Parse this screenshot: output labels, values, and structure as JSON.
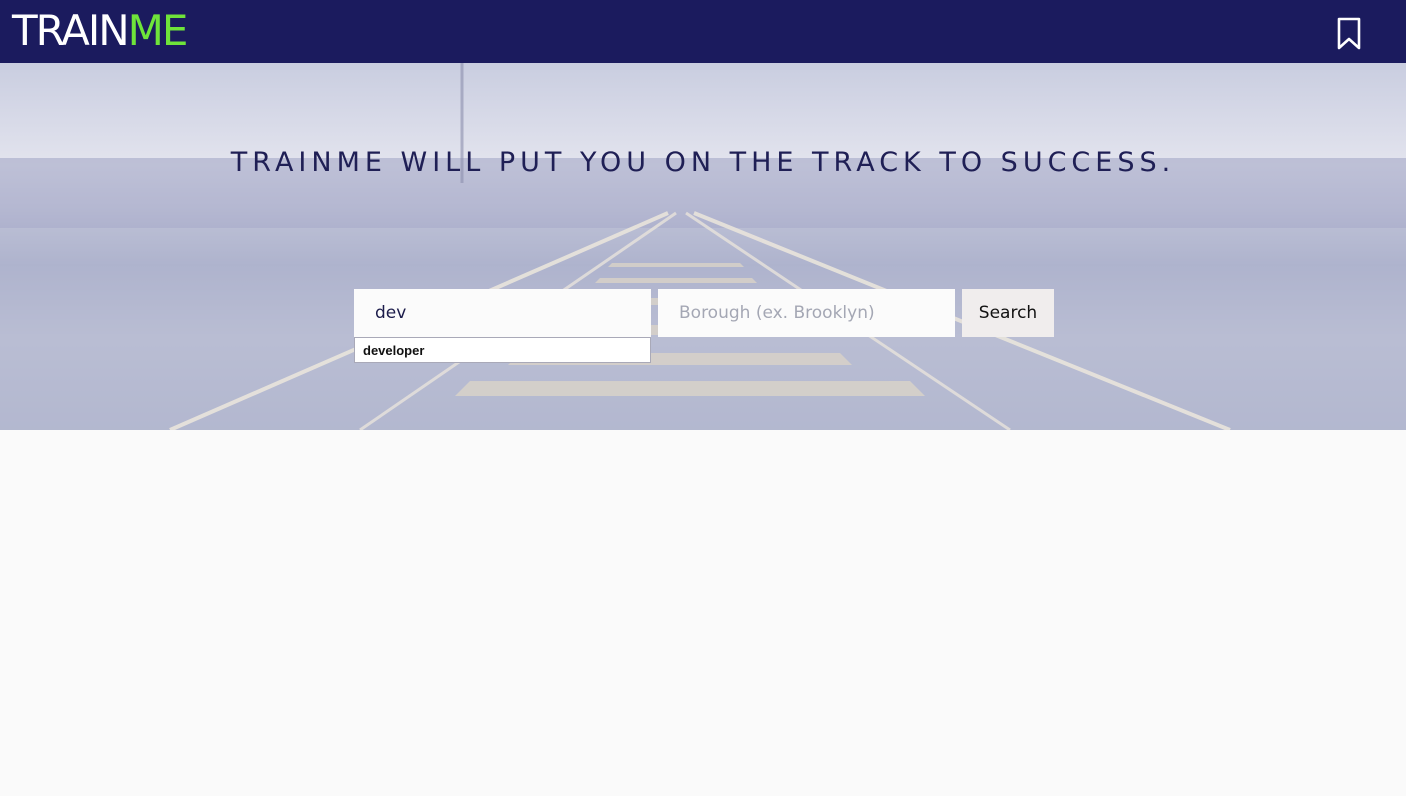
{
  "navbar": {
    "logo_part1": "TRAIN",
    "logo_part2": "ME",
    "icon": "bookmark-icon"
  },
  "hero": {
    "tagline": "TRAINME WILL PUT YOU ON THE TRACK TO SUCCESS.",
    "job_input": {
      "value": "dev",
      "placeholder": ""
    },
    "borough_input": {
      "value": "",
      "placeholder": "Borough (ex. Brooklyn)"
    },
    "search_label": "Search",
    "autocomplete": [
      "developer"
    ]
  },
  "colors": {
    "navbar_bg": "#1b1b5e",
    "logo_accent": "#6fe43a",
    "tagline": "#1f1f55"
  }
}
